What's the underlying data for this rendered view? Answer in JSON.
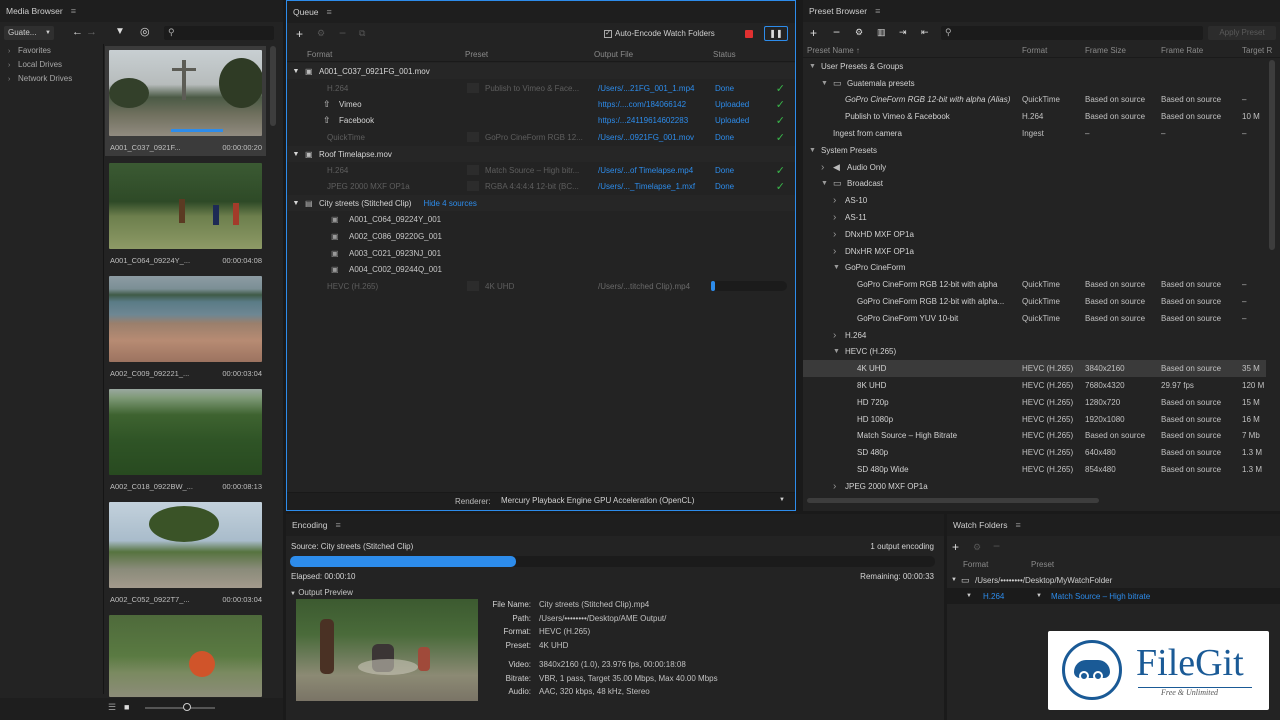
{
  "media_browser": {
    "title": "Media Browser",
    "location": "Guate...",
    "tree": [
      "Favorites",
      "Local Drives",
      "Network Drives"
    ],
    "clips": [
      {
        "name": "A001_C037_0921F...",
        "duration": "00:00:00:20"
      },
      {
        "name": "A001_C064_09224Y_...",
        "duration": "00:00:04:08"
      },
      {
        "name": "A002_C009_092221_...",
        "duration": "00:00:03:04"
      },
      {
        "name": "A002_C018_0922BW_...",
        "duration": "00:00:08:13"
      },
      {
        "name": "A002_C052_0922T7_...",
        "duration": "00:00:03:04"
      }
    ]
  },
  "queue": {
    "title": "Queue",
    "auto_encode_label": "Auto-Encode Watch Folders",
    "columns": [
      "Format",
      "Preset",
      "Output File",
      "Status"
    ],
    "renderer_label": "Renderer:",
    "renderer_value": "Mercury Playback Engine GPU Acceleration (OpenCL)",
    "groups": [
      {
        "name": "A001_C037_0921FG_001.mov",
        "items": [
          {
            "format": "H.264",
            "preset": "Publish to Vimeo & Face...",
            "output": "/Users/...21FG_001_1.mp4",
            "status": "Done"
          },
          {
            "format": "Vimeo",
            "preset": "",
            "output": "https:/....com/184066142",
            "status": "Uploaded"
          },
          {
            "format": "Facebook",
            "preset": "",
            "output": "https:/...24119614602283",
            "status": "Uploaded"
          },
          {
            "format": "QuickTime",
            "preset": "GoPro CineForm RGB 12...",
            "output": "/Users/...0921FG_001.mov",
            "status": "Done"
          }
        ]
      },
      {
        "name": "Roof Timelapse.mov",
        "items": [
          {
            "format": "H.264",
            "preset": "Match Source – High bitr...",
            "output": "/Users/...of Timelapse.mp4",
            "status": "Done"
          },
          {
            "format": "JPEG 2000 MXF OP1a",
            "preset": "RGBA 4:4:4:4 12-bit (BC...",
            "output": "/Users/..._Timelapse_1.mxf",
            "status": "Done"
          }
        ]
      },
      {
        "name": "City streets (Stitched Clip)",
        "link": "Hide 4 sources",
        "sources": [
          "A001_C064_09224Y_001",
          "A002_C086_09220G_001",
          "A003_C021_0923NJ_001",
          "A004_C002_09244Q_001"
        ],
        "items": [
          {
            "format": "HEVC (H.265)",
            "preset": "4K UHD",
            "output": "/Users/...titched Clip).mp4",
            "progress": 0.05
          }
        ]
      }
    ]
  },
  "preset_browser": {
    "title": "Preset Browser",
    "apply_label": "Apply Preset",
    "columns": [
      "Preset Name",
      "Format",
      "Frame Size",
      "Frame Rate",
      "Target R"
    ],
    "rows": [
      {
        "indent": 0,
        "tri": "v",
        "name": "User Presets & Groups",
        "format": "",
        "size": "",
        "rate": "",
        "target": ""
      },
      {
        "indent": 1,
        "tri": "v",
        "name": "Guatemala presets",
        "format": "",
        "size": "",
        "rate": "",
        "target": "",
        "folder": true
      },
      {
        "indent": 2,
        "tri": "",
        "name": "GoPro CineForm RGB 12-bit with alpha (Alias)",
        "format": "QuickTime",
        "size": "Based on source",
        "rate": "Based on source",
        "target": "–",
        "italic": true
      },
      {
        "indent": 2,
        "tri": "",
        "name": "Publish to Vimeo & Facebook",
        "format": "H.264",
        "size": "Based on source",
        "rate": "Based on source",
        "target": "10 M"
      },
      {
        "indent": 1,
        "tri": "",
        "name": "Ingest from camera",
        "format": "Ingest",
        "size": "–",
        "rate": "–",
        "target": "–"
      },
      {
        "indent": 0,
        "tri": "v",
        "name": "System Presets",
        "format": "",
        "size": "",
        "rate": "",
        "target": ""
      },
      {
        "indent": 1,
        "tri": ">",
        "name": "Audio Only",
        "format": "",
        "size": "",
        "rate": "",
        "target": "",
        "icon": "speaker"
      },
      {
        "indent": 1,
        "tri": "v",
        "name": "Broadcast",
        "format": "",
        "size": "",
        "rate": "",
        "target": "",
        "icon": "tv"
      },
      {
        "indent": 2,
        "tri": ">",
        "name": "AS-10",
        "format": "",
        "size": "",
        "rate": "",
        "target": ""
      },
      {
        "indent": 2,
        "tri": ">",
        "name": "AS-11",
        "format": "",
        "size": "",
        "rate": "",
        "target": ""
      },
      {
        "indent": 2,
        "tri": ">",
        "name": "DNxHD MXF OP1a",
        "format": "",
        "size": "",
        "rate": "",
        "target": ""
      },
      {
        "indent": 2,
        "tri": ">",
        "name": "DNxHR MXF OP1a",
        "format": "",
        "size": "",
        "rate": "",
        "target": ""
      },
      {
        "indent": 2,
        "tri": "v",
        "name": "GoPro CineForm",
        "format": "",
        "size": "",
        "rate": "",
        "target": ""
      },
      {
        "indent": 3,
        "tri": "",
        "name": "GoPro CineForm RGB 12-bit with alpha",
        "format": "QuickTime",
        "size": "Based on source",
        "rate": "Based on source",
        "target": "–"
      },
      {
        "indent": 3,
        "tri": "",
        "name": "GoPro CineForm RGB 12-bit with alpha...",
        "format": "QuickTime",
        "size": "Based on source",
        "rate": "Based on source",
        "target": "–"
      },
      {
        "indent": 3,
        "tri": "",
        "name": "GoPro CineForm YUV 10-bit",
        "format": "QuickTime",
        "size": "Based on source",
        "rate": "Based on source",
        "target": "–"
      },
      {
        "indent": 2,
        "tri": ">",
        "name": "H.264",
        "format": "",
        "size": "",
        "rate": "",
        "target": ""
      },
      {
        "indent": 2,
        "tri": "v",
        "name": "HEVC (H.265)",
        "format": "",
        "size": "",
        "rate": "",
        "target": ""
      },
      {
        "indent": 3,
        "tri": "",
        "name": "4K UHD",
        "format": "HEVC (H.265)",
        "size": "3840x2160",
        "rate": "Based on source",
        "target": "35 M",
        "selected": true
      },
      {
        "indent": 3,
        "tri": "",
        "name": "8K UHD",
        "format": "HEVC (H.265)",
        "size": "7680x4320",
        "rate": "29.97 fps",
        "target": "120 M"
      },
      {
        "indent": 3,
        "tri": "",
        "name": "HD 720p",
        "format": "HEVC (H.265)",
        "size": "1280x720",
        "rate": "Based on source",
        "target": "15 M"
      },
      {
        "indent": 3,
        "tri": "",
        "name": "HD 1080p",
        "format": "HEVC (H.265)",
        "size": "1920x1080",
        "rate": "Based on source",
        "target": "16 M"
      },
      {
        "indent": 3,
        "tri": "",
        "name": "Match Source – High Bitrate",
        "format": "HEVC (H.265)",
        "size": "Based on source",
        "rate": "Based on source",
        "target": "7 Mb"
      },
      {
        "indent": 3,
        "tri": "",
        "name": "SD 480p",
        "format": "HEVC (H.265)",
        "size": "640x480",
        "rate": "Based on source",
        "target": "1.3 M"
      },
      {
        "indent": 3,
        "tri": "",
        "name": "SD 480p Wide",
        "format": "HEVC (H.265)",
        "size": "854x480",
        "rate": "Based on source",
        "target": "1.3 M"
      },
      {
        "indent": 2,
        "tri": ">",
        "name": "JPEG 2000 MXF OP1a",
        "format": "",
        "size": "",
        "rate": "",
        "target": ""
      }
    ]
  },
  "encoding": {
    "title": "Encoding",
    "source": "Source: City streets (Stitched Clip)",
    "count": "1 output encoding",
    "progress": 0.35,
    "elapsed": "Elapsed: 00:00:10",
    "remaining": "Remaining: 00:00:33",
    "output_preview": "Output Preview",
    "info": [
      {
        "label": "File Name:",
        "value": "City streets (Stitched Clip).mp4"
      },
      {
        "label": "Path:",
        "value": "/Users/••••••••/Desktop/AME Output/"
      },
      {
        "label": "Format:",
        "value": "HEVC (H.265)"
      },
      {
        "label": "Preset:",
        "value": "4K UHD"
      },
      {
        "label": "Video:",
        "value": "3840x2160 (1.0), 23.976 fps, 00:00:18:08"
      },
      {
        "label": "Bitrate:",
        "value": "VBR, 1 pass, Target 35.00 Mbps, Max 40.00 Mbps"
      },
      {
        "label": "Audio:",
        "value": "AAC, 320 kbps, 48 kHz, Stereo"
      }
    ]
  },
  "watch_folders": {
    "title": "Watch Folders",
    "columns": [
      "Format",
      "Preset"
    ],
    "folder": "/Users/••••••••/Desktop/MyWatchFolder",
    "format": "H.264",
    "preset": "Match Source – High bitrate"
  },
  "watermark": {
    "brand": "FileGit",
    "tagline": "Free & Unlimited"
  },
  "colors": {
    "accent": "#2d8ceb",
    "done": "#39b54a",
    "panel": "#232323",
    "bg": "#1a1a1a"
  }
}
